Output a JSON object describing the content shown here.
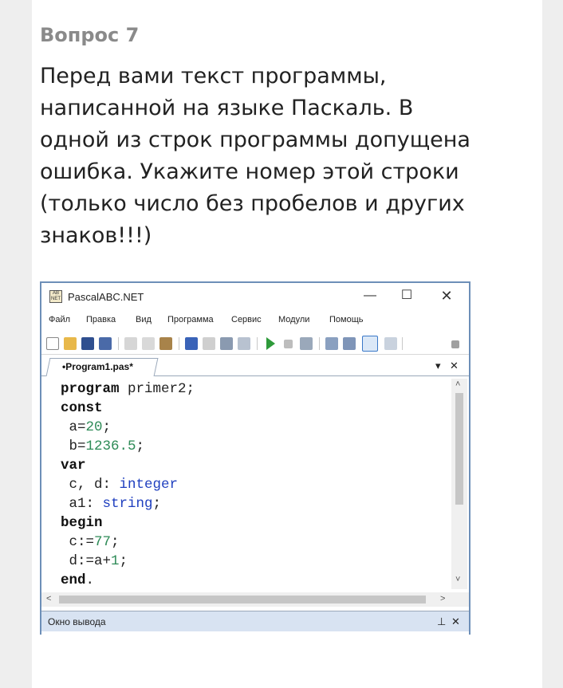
{
  "question": {
    "number_label": "Вопрос 7",
    "text": "Перед вами текст программы, написанной на языке Паскаль. В одной из строк программы допущена ошибка. Укажите номер этой строки (только число без пробелов и других знаков!!!)"
  },
  "ide": {
    "app_icon_text": "AB NET",
    "window_title": "PascalABC.NET",
    "window_controls": {
      "minimize": "—",
      "maximize": "☐",
      "close": "✕"
    },
    "menu": [
      "Файл",
      "Правка",
      "Вид",
      "Программа",
      "Сервис",
      "Модули",
      "Помощь"
    ],
    "tab_label": "•Program1.pas*",
    "tab_controls": {
      "dropdown": "▾",
      "close": "✕"
    },
    "code_lines": [
      [
        {
          "t": "program",
          "c": "kw"
        },
        {
          "t": " primer2;",
          "c": ""
        }
      ],
      [
        {
          "t": "const",
          "c": "kw"
        }
      ],
      [
        {
          "t": " a=",
          "c": ""
        },
        {
          "t": "20",
          "c": "num"
        },
        {
          "t": ";",
          "c": ""
        }
      ],
      [
        {
          "t": " b=",
          "c": ""
        },
        {
          "t": "1236.5",
          "c": "num"
        },
        {
          "t": ";",
          "c": ""
        }
      ],
      [
        {
          "t": "var",
          "c": "kw"
        }
      ],
      [
        {
          "t": " c, d: ",
          "c": ""
        },
        {
          "t": "integer",
          "c": "typ"
        }
      ],
      [
        {
          "t": " a1: ",
          "c": ""
        },
        {
          "t": "string",
          "c": "typ"
        },
        {
          "t": ";",
          "c": ""
        }
      ],
      [
        {
          "t": "begin",
          "c": "kw"
        }
      ],
      [
        {
          "t": " c:=",
          "c": ""
        },
        {
          "t": "77",
          "c": "num"
        },
        {
          "t": ";",
          "c": ""
        }
      ],
      [
        {
          "t": " d:=a+",
          "c": ""
        },
        {
          "t": "1",
          "c": "num"
        },
        {
          "t": ";",
          "c": ""
        }
      ],
      [
        {
          "t": "end",
          "c": "kw"
        },
        {
          "t": ".",
          "c": ""
        }
      ]
    ],
    "scroll_arrows": {
      "up": "˄",
      "down": "˅",
      "left": "<",
      "right": ">"
    },
    "output_panel": {
      "label": "Окно вывода",
      "pin": "⊥",
      "close": "✕"
    }
  }
}
